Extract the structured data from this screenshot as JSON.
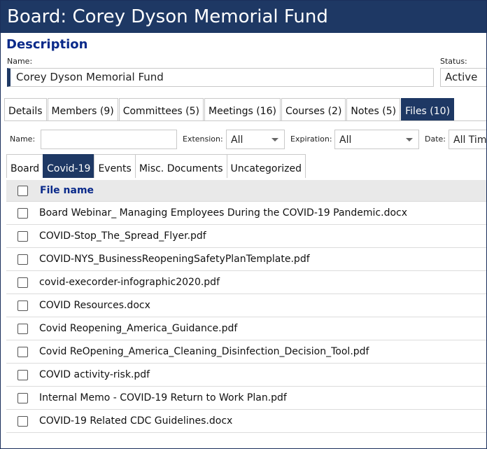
{
  "window": {
    "title": "Board: Corey Dyson Memorial Fund"
  },
  "description": {
    "heading": "Description",
    "name_label": "Name:",
    "name_value": "Corey Dyson Memorial Fund",
    "status_label": "Status:",
    "status_value": "Active"
  },
  "main_tabs": [
    {
      "label": "Details",
      "active": false
    },
    {
      "label": "Members (9)",
      "active": false
    },
    {
      "label": "Committees (5)",
      "active": false
    },
    {
      "label": "Meetings (16)",
      "active": false
    },
    {
      "label": "Courses (2)",
      "active": false
    },
    {
      "label": "Notes (5)",
      "active": false
    },
    {
      "label": "Files (10)",
      "active": true
    }
  ],
  "filters": {
    "name_label": "Name:",
    "name_value": "",
    "extension_label": "Extension:",
    "extension_value": "All",
    "expiration_label": "Expiration:",
    "expiration_value": "All",
    "date_label": "Date:",
    "date_value": "All Tim"
  },
  "sub_tabs": [
    {
      "label": "Board",
      "active": false
    },
    {
      "label": "Covid-19",
      "active": true
    },
    {
      "label": "Events",
      "active": false
    },
    {
      "label": "Misc. Documents",
      "active": false
    },
    {
      "label": "Uncategorized",
      "active": false
    }
  ],
  "table": {
    "header": "File name",
    "rows": [
      "Board Webinar_ Managing Employees During the COVID-19 Pandemic.docx",
      "COVID-Stop_The_Spread_Flyer.pdf",
      "COVID-NYS_BusinessReopeningSafetyPlanTemplate.pdf",
      "covid-execorder-infographic2020.pdf",
      "COVID Resources.docx",
      "Covid Reopening_America_Guidance.pdf",
      "Covid ReOpening_America_Cleaning_Disinfection_Decision_Tool.pdf",
      "COVID activity-risk.pdf",
      "Internal Memo - COVID-19 Return to Work Plan.pdf",
      "COVID-19 Related CDC Guidelines.docx"
    ]
  },
  "colors": {
    "accent": "#1e3864",
    "heading": "#0a2a8a"
  }
}
